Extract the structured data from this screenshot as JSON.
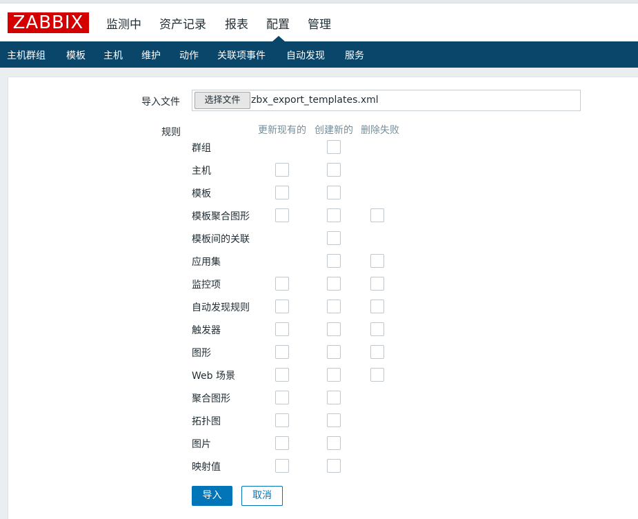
{
  "app": {
    "logo": "ZABBIX"
  },
  "main_nav": [
    {
      "label": "监测中",
      "active": false
    },
    {
      "label": "资产记录",
      "active": false
    },
    {
      "label": "报表",
      "active": false
    },
    {
      "label": "配置",
      "active": true
    },
    {
      "label": "管理",
      "active": false
    }
  ],
  "sub_nav": [
    "主机群组",
    "模板",
    "主机",
    "维护",
    "动作",
    "关联项事件",
    "自动发现",
    "服务"
  ],
  "form": {
    "import_file_label": "导入文件",
    "choose_file_button": "选择文件",
    "file_name": "zbx_export_templates.xml",
    "rules_label": "规则",
    "columns": [
      "更新现有的",
      "创建新的",
      "删除失败"
    ],
    "rules": [
      {
        "label": "群组",
        "update": null,
        "create": false,
        "delete": null
      },
      {
        "label": "主机",
        "update": false,
        "create": false,
        "delete": null
      },
      {
        "label": "模板",
        "update": false,
        "create": false,
        "delete": null
      },
      {
        "label": "模板聚合图形",
        "update": false,
        "create": false,
        "delete": false
      },
      {
        "label": "模板间的关联",
        "update": null,
        "create": false,
        "delete": null
      },
      {
        "label": "应用集",
        "update": null,
        "create": false,
        "delete": false
      },
      {
        "label": "监控项",
        "update": false,
        "create": false,
        "delete": false
      },
      {
        "label": "自动发现规则",
        "update": false,
        "create": false,
        "delete": false
      },
      {
        "label": "触发器",
        "update": false,
        "create": false,
        "delete": false
      },
      {
        "label": "图形",
        "update": false,
        "create": false,
        "delete": false
      },
      {
        "label": "Web 场景",
        "update": false,
        "create": false,
        "delete": false
      },
      {
        "label": "聚合图形",
        "update": false,
        "create": false,
        "delete": null
      },
      {
        "label": "拓扑图",
        "update": false,
        "create": false,
        "delete": null
      },
      {
        "label": "图片",
        "update": false,
        "create": false,
        "delete": null
      },
      {
        "label": "映射值",
        "update": false,
        "create": false,
        "delete": null
      }
    ],
    "import_button": "导入",
    "cancel_button": "取消"
  },
  "colors": {
    "header_bg": "#0a466a",
    "logo_bg": "#d40000",
    "primary": "#0275b8"
  }
}
